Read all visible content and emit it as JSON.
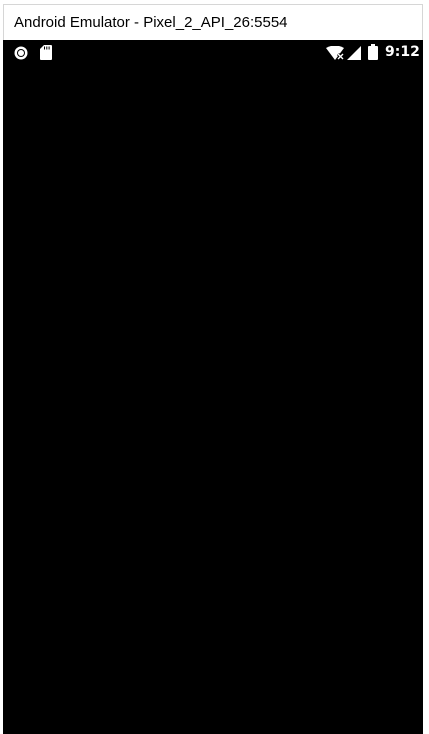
{
  "window": {
    "title": "Android Emulator - Pixel_2_API_26:5554"
  },
  "status_bar": {
    "time": "9:12",
    "left_icons": [
      "record-icon",
      "sd-card-icon"
    ],
    "right_icons": [
      "wifi-no-internet-icon",
      "cellular-signal-icon",
      "battery-icon"
    ]
  },
  "screen": {
    "background": "#000000"
  }
}
